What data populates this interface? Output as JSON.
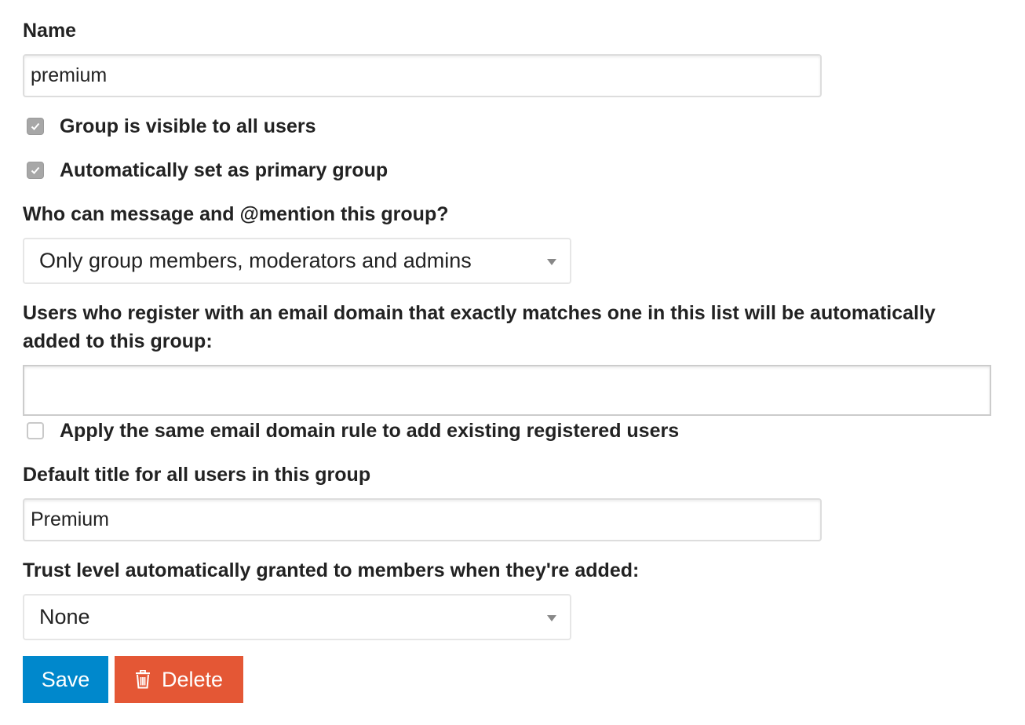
{
  "form": {
    "name": {
      "label": "Name",
      "value": "premium"
    },
    "visible_to_all": {
      "label": "Group is visible to all users",
      "checked": true
    },
    "primary_group": {
      "label": "Automatically set as primary group",
      "checked": true
    },
    "mention": {
      "label": "Who can message and @mention this group?",
      "selected": "Only group members, moderators and admins"
    },
    "email_domains": {
      "label": "Users who register with an email domain that exactly matches one in this list will be automatically added to this group:",
      "value": ""
    },
    "apply_existing": {
      "label": "Apply the same email domain rule to add existing registered users",
      "checked": false
    },
    "default_title": {
      "label": "Default title for all users in this group",
      "value": "Premium"
    },
    "trust_level": {
      "label": "Trust level automatically granted to members when they're added:",
      "selected": "None"
    }
  },
  "actions": {
    "save_label": "Save",
    "delete_label": "Delete",
    "delete_icon": "trash-icon"
  },
  "colors": {
    "save": "#0088cc",
    "delete": "#e45735",
    "checkbox_checked": "#a7a7a7"
  }
}
